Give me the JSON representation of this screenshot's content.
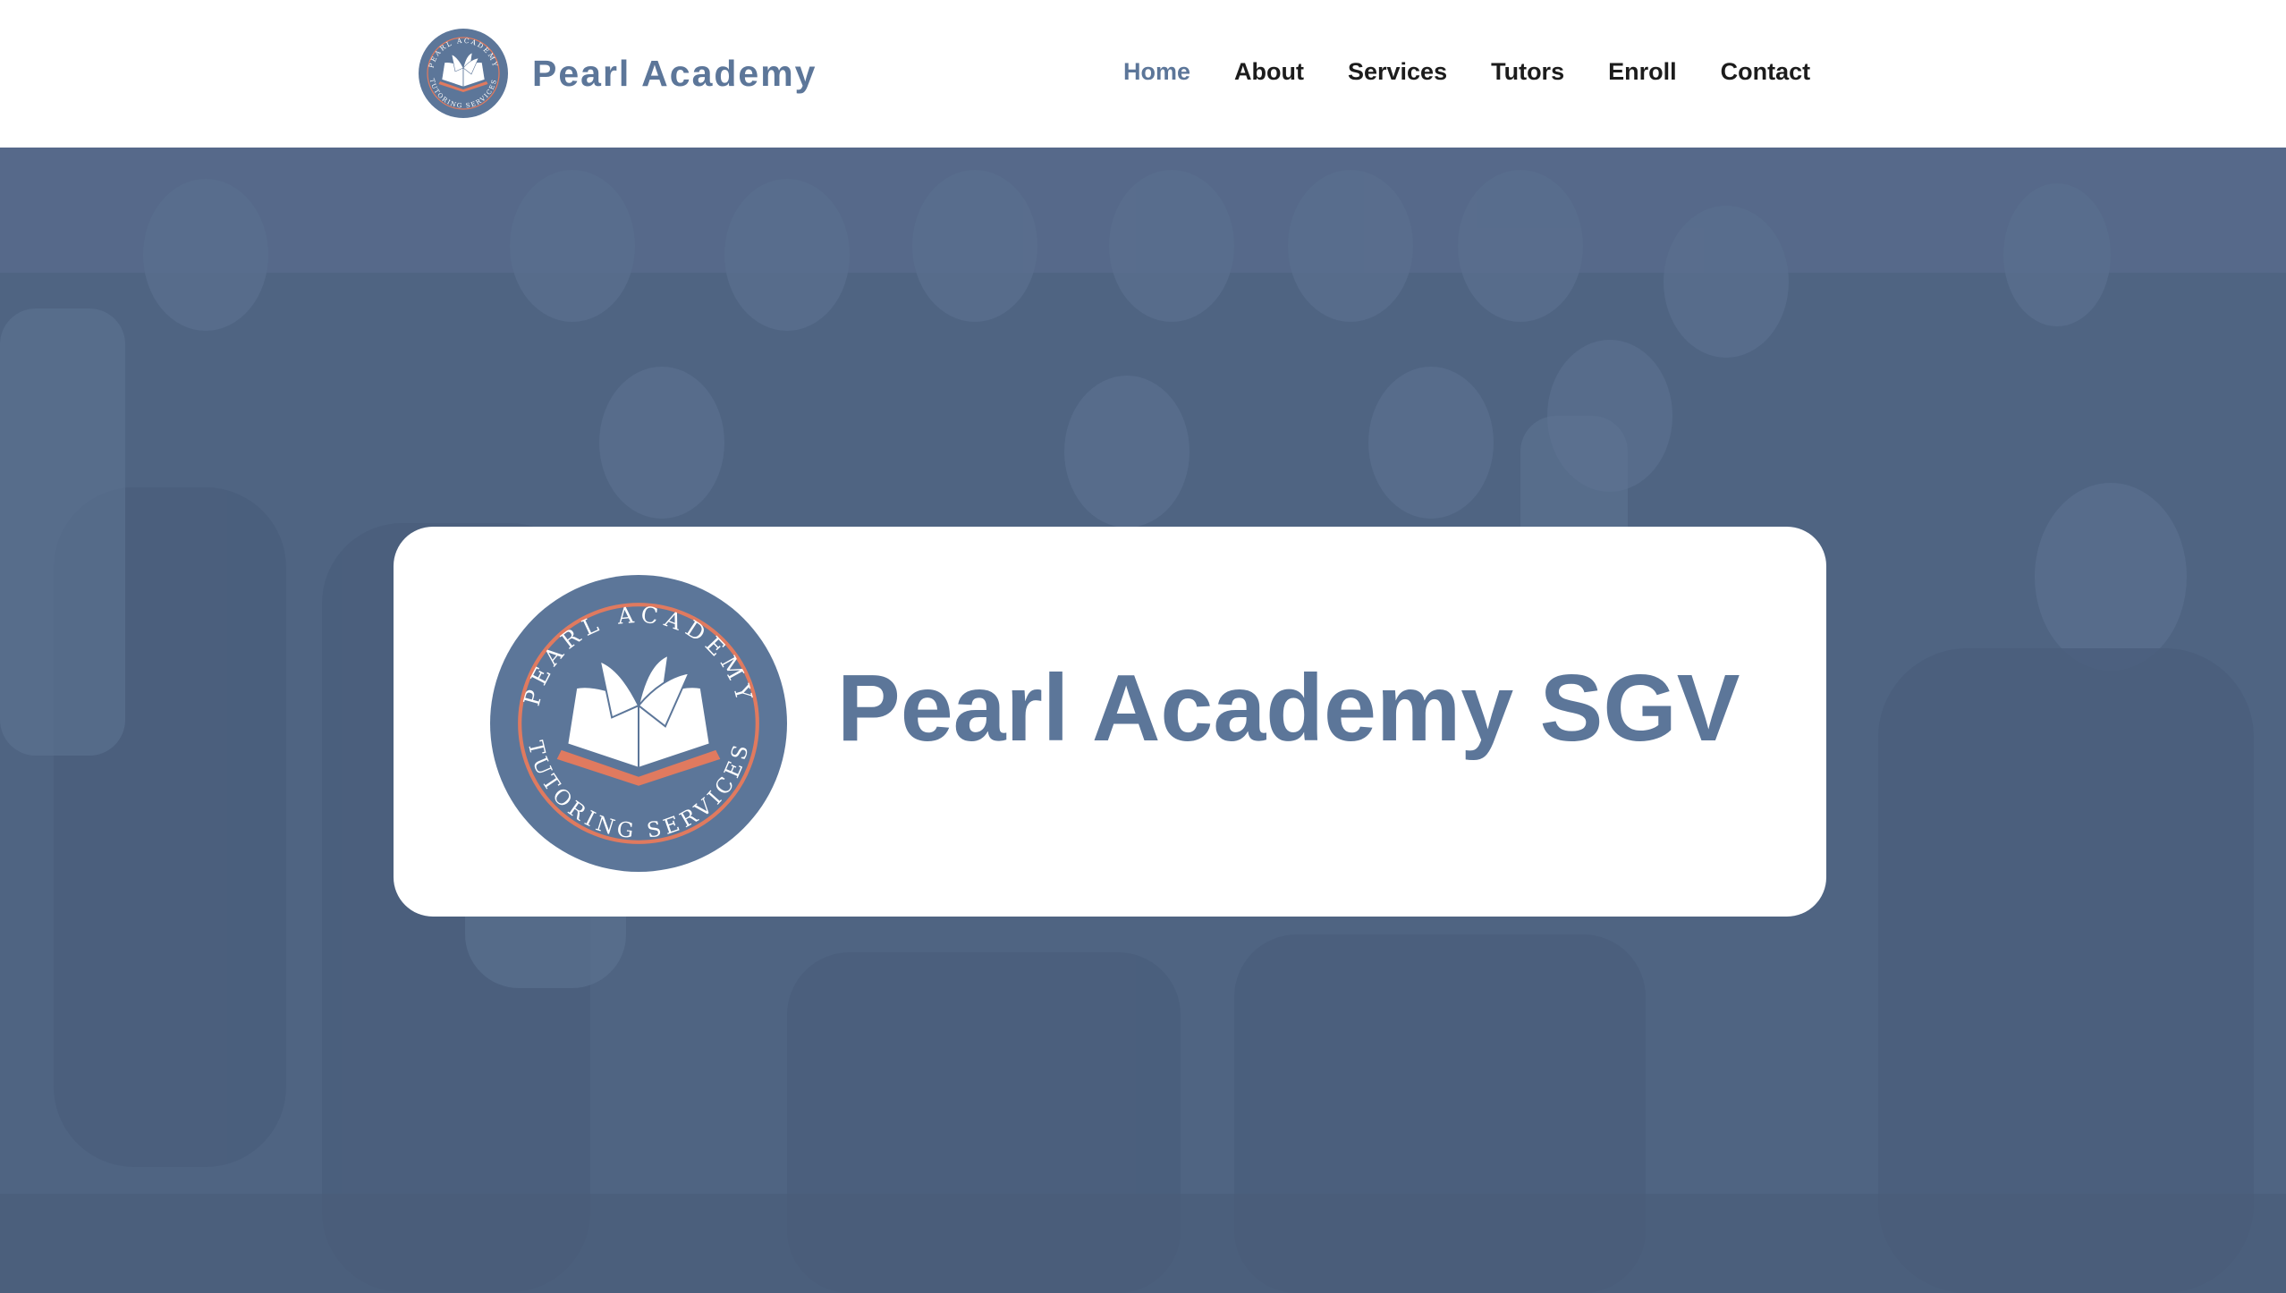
{
  "header": {
    "brand_name": "Pearl Academy",
    "nav": [
      {
        "label": "Home",
        "active": true
      },
      {
        "label": "About",
        "active": false
      },
      {
        "label": "Services",
        "active": false
      },
      {
        "label": "Tutors",
        "active": false
      },
      {
        "label": "Enroll",
        "active": false
      },
      {
        "label": "Contact",
        "active": false
      }
    ]
  },
  "logo": {
    "icon": "open-book-seal",
    "ring_text_top": "PEARL ACADEMY",
    "ring_text_bottom": "TUTORING SERVICES"
  },
  "hero": {
    "title": "Pearl Academy SGV",
    "background_icon": "group-photo-overlay"
  },
  "colors": {
    "brand": "#5c7699",
    "overlay": "#4f6482",
    "accent": "#e07a5f",
    "nav_text": "#1c1c1c",
    "card": "#ffffff"
  }
}
